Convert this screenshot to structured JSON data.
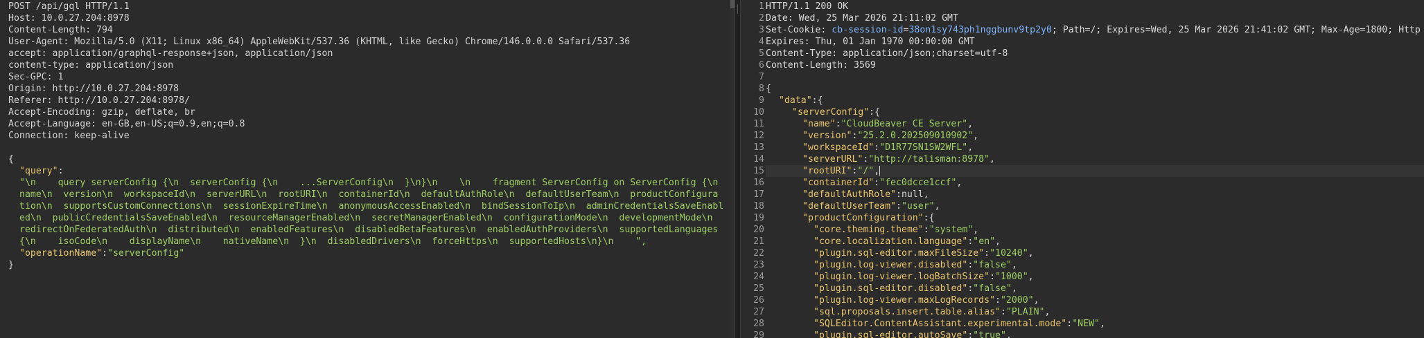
{
  "request": {
    "headers": [
      {
        "text": "POST /api/gql HTTP/1.1"
      },
      {
        "text": "Host: 10.0.27.204:8978"
      },
      {
        "text": "Content-Length: 794"
      },
      {
        "text": "User-Agent: Mozilla/5.0 (X11; Linux x86_64) AppleWebKit/537.36 (KHTML, like Gecko) Chrome/146.0.0.0 Safari/537.36"
      },
      {
        "text": "accept: application/graphql-response+json, application/json"
      },
      {
        "text": "content-type: application/json"
      },
      {
        "text": "Sec-GPC: 1"
      },
      {
        "text": "Origin: http://10.0.27.204:8978"
      },
      {
        "text": "Referer: http://10.0.27.204:8978/"
      },
      {
        "text": "Accept-Encoding: gzip, deflate, br"
      },
      {
        "text": "Accept-Language: en-GB,en-US;q=0.9,en;q=0.8"
      },
      {
        "text": "Connection: keep-alive"
      }
    ],
    "body": {
      "open": "{",
      "query_key": "\"query\"",
      "colon": ":",
      "query_lines": [
        "\"\\n    query serverConfig {\\n  serverConfig {\\n    ...ServerConfig\\n  }\\n}\\n    \\n    fragment ServerConfig on ServerConfig {\\n",
        "name\\n  version\\n  workspaceId\\n  serverURL\\n  rootURI\\n  containerId\\n  defaultAuthRole\\n  defaultUserTeam\\n  productConfigura",
        "tion\\n  supportsCustomConnections\\n  sessionExpireTime\\n  anonymousAccessEnabled\\n  bindSessionToIp\\n  adminCredentialsSaveEnabl",
        "ed\\n  publicCredentialsSaveEnabled\\n  resourceManagerEnabled\\n  secretManagerEnabled\\n  configurationMode\\n  developmentMode\\n",
        "redirectOnFederatedAuth\\n  distributed\\n  enabledFeatures\\n  disabledBetaFeatures\\n  enabledAuthProviders\\n  supportedLanguages",
        "{\\n    isoCode\\n    displayName\\n    nativeName\\n  }\\n  disabledDrivers\\n  forceHttps\\n  supportedHosts\\n}\\n    \","
      ],
      "opname_key": "\"operationName\"",
      "opname_value": "\"serverConfig\"",
      "close": "}"
    }
  },
  "response": {
    "line_numbers": [
      "1",
      "2",
      "3",
      "4",
      "5",
      "6",
      "7",
      "8",
      "9",
      "10",
      "11",
      "12",
      "13",
      "14",
      "15",
      "16",
      "17",
      "18",
      "19",
      "20",
      "21",
      "22",
      "23",
      "24",
      "25",
      "26",
      "27",
      "28",
      "29"
    ],
    "status_line": "HTTP/1.1 200 OK",
    "date_line": "Date: Wed, 25 Mar 2026 21:11:02 GMT",
    "set_cookie_prefix": "Set-Cookie: ",
    "set_cookie_name": "cb-session-id",
    "set_cookie_eq": "=",
    "set_cookie_value": "38on1sy743ph1nggbunv9tp2y0",
    "set_cookie_rest": "; Path=/; Expires=Wed, 25 Mar 2026 21:41:02 GMT; Max-Age=1800; Http",
    "expires_line": "Expires: Thu, 01 Jan 1970 00:00:00 GMT",
    "content_type_line": "Content-Type: application/json;charset=utf-8",
    "content_length_line": "Content-Length: 3569",
    "json": [
      {
        "indent": 1,
        "k": "",
        "v": "{",
        "raw": true
      },
      {
        "indent": 2,
        "k": "\"data\"",
        "v": "{",
        "obj": true
      },
      {
        "indent": 3,
        "k": "\"serverConfig\"",
        "v": "{",
        "obj": true
      },
      {
        "indent": 4,
        "k": "\"name\"",
        "v": "\"CloudBeaver CE Server\""
      },
      {
        "indent": 4,
        "k": "\"version\"",
        "v": "\"25.2.0.202509010902\""
      },
      {
        "indent": 4,
        "k": "\"workspaceId\"",
        "v": "\"D1R77SN1SW2WFL\""
      },
      {
        "indent": 4,
        "k": "\"serverURL\"",
        "v": "\"http://talisman:8978\""
      },
      {
        "indent": 4,
        "k": "\"rootURI\"",
        "v": "\"/\"",
        "caret": true
      },
      {
        "indent": 4,
        "k": "\"containerId\"",
        "v": "\"fec0dcce1ccf\""
      },
      {
        "indent": 4,
        "k": "\"defaultAuthRole\"",
        "v": "null",
        "kw": true
      },
      {
        "indent": 4,
        "k": "\"defaultUserTeam\"",
        "v": "\"user\""
      },
      {
        "indent": 4,
        "k": "\"productConfiguration\"",
        "v": "{",
        "obj": true
      },
      {
        "indent": 5,
        "k": "\"core.theming.theme\"",
        "v": "\"system\""
      },
      {
        "indent": 5,
        "k": "\"core.localization.language\"",
        "v": "\"en\""
      },
      {
        "indent": 5,
        "k": "\"plugin.sql-editor.maxFileSize\"",
        "v": "\"10240\""
      },
      {
        "indent": 5,
        "k": "\"plugin.log-viewer.disabled\"",
        "v": "\"false\""
      },
      {
        "indent": 5,
        "k": "\"plugin.log-viewer.logBatchSize\"",
        "v": "\"1000\""
      },
      {
        "indent": 5,
        "k": "\"plugin.sql-editor.disabled\"",
        "v": "\"false\""
      },
      {
        "indent": 5,
        "k": "\"plugin.log-viewer.maxLogRecords\"",
        "v": "\"2000\""
      },
      {
        "indent": 5,
        "k": "\"sql.proposals.insert.table.alias\"",
        "v": "\"PLAIN\""
      },
      {
        "indent": 5,
        "k": "\"SQLEditor.ContentAssistant.experimental.mode\"",
        "v": "\"NEW\""
      },
      {
        "indent": 5,
        "k": "\"plugin.sql-editor.autoSave\"",
        "v": "\"true\""
      }
    ]
  }
}
